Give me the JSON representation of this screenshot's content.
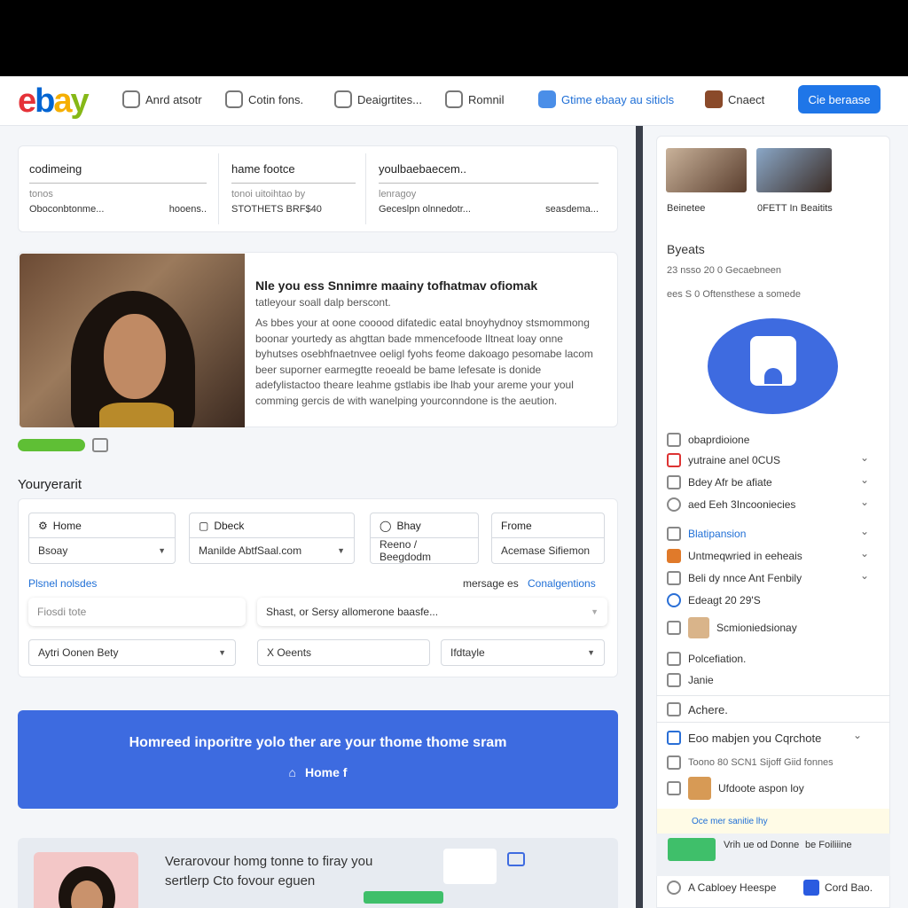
{
  "header": {
    "logo_letters": [
      "e",
      "b",
      "a",
      "y"
    ],
    "nav": [
      {
        "label": "Anrd atsotr",
        "icon": "users-icon"
      },
      {
        "label": "Cotin fons.",
        "icon": "transfer-icon"
      },
      {
        "label": "Deaigrtites...",
        "icon": "design-icon"
      },
      {
        "label": "Romnil",
        "icon": "message-icon"
      },
      {
        "label": "Gtime ebaay au siticls",
        "icon": "calendar-icon"
      },
      {
        "label": "Cnaect",
        "icon": "profile-icon"
      }
    ],
    "cta_label": "Cie beraase"
  },
  "summary": [
    {
      "title": "codimeing",
      "sub": "tonos",
      "left": "Oboconbtonme...",
      "right": "hooens.."
    },
    {
      "title": "hame footce",
      "sub": "tonoi uitoihtao by",
      "left": "STOTHETS BRF$40",
      "right": ""
    },
    {
      "title": "youlbaebaecem..",
      "sub": "lenragoy",
      "left": "Geceslpn olnnedotr...",
      "right": "seasdema..."
    }
  ],
  "profile": {
    "title": "Nle you ess Snnimre maainy tofhatmav ofiomak",
    "subtitle": "tatleyour soall dalp berscont.",
    "body": "As bbes your at oone cooood difatedic eatal bnoyhydnoy stsmommong boonar yourtedy as ahgttan bade mmencefoode Iltneat loay onne byhutses osebhfnaetnvee oeligl fyohs feome dakoago pesomabe lacom beer suporner earmegtte reoeald be bame lefesate is donide adefylistactoo theare leahme gstlabis ibe lhab your areme your youl comming gercis de with wanelping yourconndone is the aeution."
  },
  "form": {
    "section_title": "Youryerarit",
    "fields": [
      {
        "label": "Home",
        "value": "Bsoay"
      },
      {
        "label": "Dbeck",
        "value": "Manilde AbtfSaal.com"
      },
      {
        "label": "Bhay",
        "value": "Reeno / Beegdodm"
      },
      {
        "label": "Frome",
        "value": "Acemase Sifiemon"
      }
    ],
    "link_left": "Plsnel nolsdes",
    "mid_text": "mersage es",
    "link_right": "Conalgentions",
    "placeholder_left": "Fiosdi tote",
    "placeholder_right": "Shast, or Sersy allomerone baasfe...",
    "bottom_fields": [
      "Aytri Oonen Bety",
      "X Oeents",
      "Ifdtayle"
    ]
  },
  "banner": {
    "text": "Homreed inporitre yolo ther are your thome thome sram",
    "button": "Home f"
  },
  "bottom": {
    "line1": "Verarovour homg tonne to firay you",
    "line2": "sertlerp Cto fovour eguen"
  },
  "sidebar": {
    "captions": [
      "Beinetee",
      "0FETT In Beaitits"
    ],
    "heading": "Byeats",
    "meta": [
      "23 nsso 20 0 Gecaebneen",
      "ees S 0 Oftensthese a somede"
    ],
    "rows": [
      {
        "label": "obaprdioione",
        "chev": false
      },
      {
        "label": "yutraine anel 0CUS",
        "chev": true
      },
      {
        "label": "Bdey Afr be afiate",
        "chev": true
      },
      {
        "label": "aed Eeh 3Incooniecies",
        "chev": true
      },
      {
        "label": "Blatipansion",
        "chev": true
      },
      {
        "label": "Untmeqwried in eeheais",
        "chev": true
      },
      {
        "label": "Beli dy nnce Ant Fenbily",
        "chev": true
      },
      {
        "label": "Edeagt 20 29'S",
        "chev": false
      },
      {
        "label": "Scmioniedsionay",
        "chev": false
      },
      {
        "label": "Polcefiation.",
        "chev": false
      },
      {
        "label": "Janie",
        "chev": false
      }
    ],
    "achere": "Achere.",
    "expand": "Eoo mabjen you Cqrchote",
    "bot1": "Toono 80 SCN1 Sijoff Giid fonnes",
    "bot2": "Ufdoote aspon loy",
    "bot3": "Oce mer sanitie lhy",
    "bot4": "Vrih ue od Donne",
    "bot5": "be Foiliiine",
    "bot6": "A Cabloey Heespe",
    "bot7": "Cord Bao."
  },
  "colors": {
    "accent": "#1f76e8",
    "banner": "#3d6be0",
    "header_bg": "#000000"
  }
}
